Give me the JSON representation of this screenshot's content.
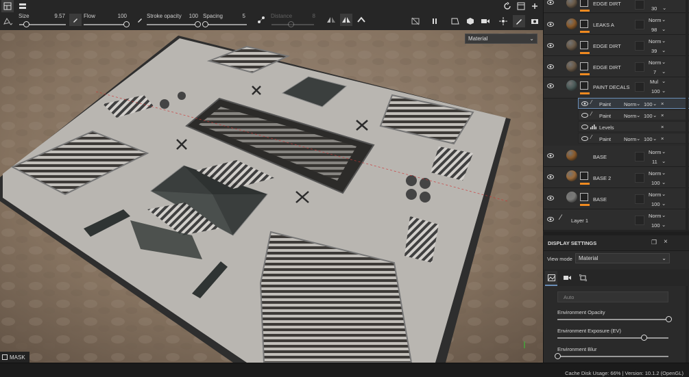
{
  "toolbar": {
    "size_label": "Size",
    "size_value": "9.57",
    "size_level": 0.15,
    "flow_label": "Flow",
    "flow_value": "100",
    "flow_level": 1.0,
    "stroke_opacity_label": "Stroke opacity",
    "stroke_opacity_value": "100",
    "stroke_opacity_level": 1.0,
    "spacing_label": "Spacing",
    "spacing_value": "5",
    "spacing_level": 0.02,
    "distance_label": "Distance",
    "distance_value": "8",
    "distance_level": 0.45
  },
  "viewport": {
    "material_dropdown": "Material",
    "mask_badge": "MASK"
  },
  "layers": [
    {
      "name": "EDGE DIRT",
      "blend": "",
      "opacity": "30",
      "ball": "#6a5a48"
    },
    {
      "name": "LEAKS A",
      "blend": "Norm",
      "opacity": "98",
      "ball": "#8a5a2a"
    },
    {
      "name": "EDGE DIRT",
      "blend": "Norm",
      "opacity": "39",
      "ball": "#6a5a48"
    },
    {
      "name": "EDGE DIRT",
      "blend": "Norm",
      "opacity": "7",
      "ball": "#6a5a48"
    },
    {
      "name": "PAINT DECALS",
      "blend": "Mul",
      "opacity": "100",
      "ball": "#4a5a58"
    }
  ],
  "sublayers": [
    {
      "name": "Paint",
      "blend": "Norm",
      "opacity": "100"
    },
    {
      "name": "Paint",
      "blend": "Norm",
      "opacity": "100"
    },
    {
      "name": "Levels",
      "blend": "",
      "opacity": ""
    },
    {
      "name": "Paint",
      "blend": "Norm",
      "opacity": "100"
    }
  ],
  "layers2": [
    {
      "name": "BASE",
      "blend": "Norm",
      "opacity": "11",
      "ball": "#8a5a2a"
    },
    {
      "name": "BASE 2",
      "blend": "Norm",
      "opacity": "100",
      "ball": "#9a6a3a"
    },
    {
      "name": "BASE",
      "blend": "Norm",
      "opacity": "100",
      "ball": "#7a7a78"
    },
    {
      "name": "Layer 1",
      "blend": "Norm",
      "opacity": "100",
      "ball": ""
    }
  ],
  "display": {
    "title": "DISPLAY SETTINGS",
    "view_mode_label": "View mode",
    "view_mode_value": "Material",
    "auto_placeholder": "Auto",
    "env_opacity_label": "Environment Opacity",
    "env_opacity_level": 1.0,
    "env_exposure_label": "Environment Exposure (EV)",
    "env_exposure_level": 0.78,
    "env_blur_label": "Environment Blur",
    "env_blur_level": 0.0
  },
  "status": {
    "text": "Cache Disk Usage:   66% | Version: 10.1.2 (OpenGL)"
  },
  "colors": {
    "accent_orange": "#f08a20",
    "panel_bg": "#2a2a2a",
    "selection_border": "#6b8fb8"
  }
}
